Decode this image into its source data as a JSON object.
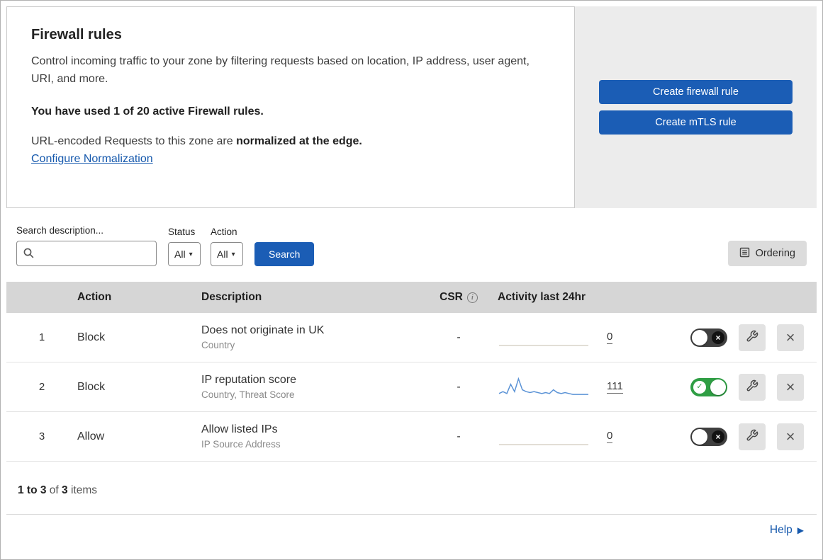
{
  "header": {
    "title": "Firewall rules",
    "description": "Control incoming traffic to your zone by filtering requests based on location, IP address, user agent, URI, and more.",
    "usage_line": "You have used 1 of 20 active Firewall rules.",
    "normalization_prefix": "URL-encoded Requests to this zone are ",
    "normalization_bold": "normalized at the edge.",
    "normalization_link": "Configure Normalization",
    "buttons": {
      "create_firewall": "Create firewall rule",
      "create_mtls": "Create mTLS rule"
    }
  },
  "filters": {
    "search_label": "Search description...",
    "status_label": "Status",
    "status_value": "All",
    "action_label": "Action",
    "action_value": "All",
    "search_button": "Search",
    "ordering_button": "Ordering"
  },
  "table": {
    "columns": {
      "action": "Action",
      "description": "Description",
      "csr": "CSR",
      "activity": "Activity last 24hr"
    },
    "rows": [
      {
        "index": "1",
        "action": "Block",
        "description": "Does not originate in UK",
        "fields": "Country",
        "csr": "-",
        "activity_count": "0",
        "enabled": false,
        "activity_points": []
      },
      {
        "index": "2",
        "action": "Block",
        "description": "IP reputation score",
        "fields": "Country, Threat Score",
        "csr": "-",
        "activity_count": "111",
        "enabled": true,
        "activity_points": [
          2,
          3,
          2,
          7,
          3,
          10,
          4,
          3,
          2.5,
          3,
          2.5,
          2,
          2.5,
          2,
          4,
          2.5,
          2,
          2.5,
          2,
          1.5,
          1.5,
          1.5,
          1.5,
          1.5
        ]
      },
      {
        "index": "3",
        "action": "Allow",
        "description": "Allow listed IPs",
        "fields": "IP Source Address",
        "csr": "-",
        "activity_count": "0",
        "enabled": false,
        "activity_points": []
      }
    ]
  },
  "footer": {
    "range_bold": "1 to 3",
    "of_text": " of ",
    "total_bold": "3",
    "items_text": " items",
    "help": "Help"
  },
  "colors": {
    "accent": "#1b5db5",
    "link": "#1659ad",
    "toggle_on": "#2f9e44",
    "sparkline": "#5b93d6",
    "flatline": "#d8d4c8",
    "table_header_bg": "#d6d6d6",
    "panel_bg": "#ececec"
  }
}
